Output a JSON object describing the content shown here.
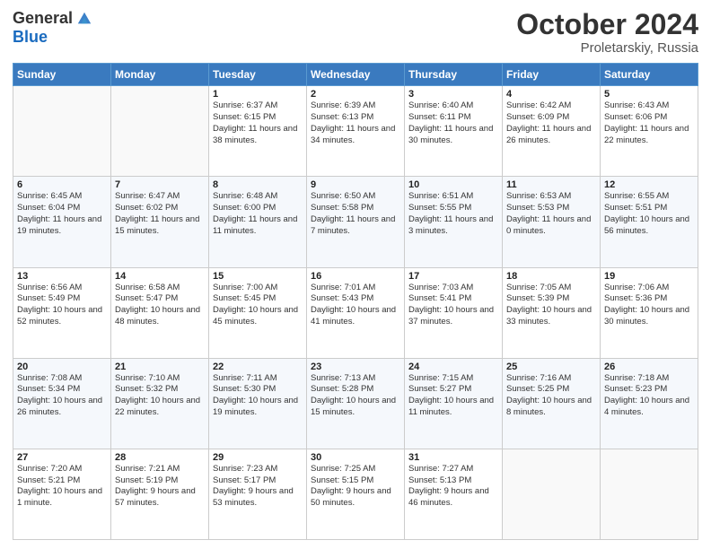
{
  "header": {
    "logo_general": "General",
    "logo_blue": "Blue",
    "month_title": "October 2024",
    "subtitle": "Proletarskiy, Russia"
  },
  "days_of_week": [
    "Sunday",
    "Monday",
    "Tuesday",
    "Wednesday",
    "Thursday",
    "Friday",
    "Saturday"
  ],
  "weeks": [
    [
      {
        "day": "",
        "info": ""
      },
      {
        "day": "",
        "info": ""
      },
      {
        "day": "1",
        "info": "Sunrise: 6:37 AM\nSunset: 6:15 PM\nDaylight: 11 hours and 38 minutes."
      },
      {
        "day": "2",
        "info": "Sunrise: 6:39 AM\nSunset: 6:13 PM\nDaylight: 11 hours and 34 minutes."
      },
      {
        "day": "3",
        "info": "Sunrise: 6:40 AM\nSunset: 6:11 PM\nDaylight: 11 hours and 30 minutes."
      },
      {
        "day": "4",
        "info": "Sunrise: 6:42 AM\nSunset: 6:09 PM\nDaylight: 11 hours and 26 minutes."
      },
      {
        "day": "5",
        "info": "Sunrise: 6:43 AM\nSunset: 6:06 PM\nDaylight: 11 hours and 22 minutes."
      }
    ],
    [
      {
        "day": "6",
        "info": "Sunrise: 6:45 AM\nSunset: 6:04 PM\nDaylight: 11 hours and 19 minutes."
      },
      {
        "day": "7",
        "info": "Sunrise: 6:47 AM\nSunset: 6:02 PM\nDaylight: 11 hours and 15 minutes."
      },
      {
        "day": "8",
        "info": "Sunrise: 6:48 AM\nSunset: 6:00 PM\nDaylight: 11 hours and 11 minutes."
      },
      {
        "day": "9",
        "info": "Sunrise: 6:50 AM\nSunset: 5:58 PM\nDaylight: 11 hours and 7 minutes."
      },
      {
        "day": "10",
        "info": "Sunrise: 6:51 AM\nSunset: 5:55 PM\nDaylight: 11 hours and 3 minutes."
      },
      {
        "day": "11",
        "info": "Sunrise: 6:53 AM\nSunset: 5:53 PM\nDaylight: 11 hours and 0 minutes."
      },
      {
        "day": "12",
        "info": "Sunrise: 6:55 AM\nSunset: 5:51 PM\nDaylight: 10 hours and 56 minutes."
      }
    ],
    [
      {
        "day": "13",
        "info": "Sunrise: 6:56 AM\nSunset: 5:49 PM\nDaylight: 10 hours and 52 minutes."
      },
      {
        "day": "14",
        "info": "Sunrise: 6:58 AM\nSunset: 5:47 PM\nDaylight: 10 hours and 48 minutes."
      },
      {
        "day": "15",
        "info": "Sunrise: 7:00 AM\nSunset: 5:45 PM\nDaylight: 10 hours and 45 minutes."
      },
      {
        "day": "16",
        "info": "Sunrise: 7:01 AM\nSunset: 5:43 PM\nDaylight: 10 hours and 41 minutes."
      },
      {
        "day": "17",
        "info": "Sunrise: 7:03 AM\nSunset: 5:41 PM\nDaylight: 10 hours and 37 minutes."
      },
      {
        "day": "18",
        "info": "Sunrise: 7:05 AM\nSunset: 5:39 PM\nDaylight: 10 hours and 33 minutes."
      },
      {
        "day": "19",
        "info": "Sunrise: 7:06 AM\nSunset: 5:36 PM\nDaylight: 10 hours and 30 minutes."
      }
    ],
    [
      {
        "day": "20",
        "info": "Sunrise: 7:08 AM\nSunset: 5:34 PM\nDaylight: 10 hours and 26 minutes."
      },
      {
        "day": "21",
        "info": "Sunrise: 7:10 AM\nSunset: 5:32 PM\nDaylight: 10 hours and 22 minutes."
      },
      {
        "day": "22",
        "info": "Sunrise: 7:11 AM\nSunset: 5:30 PM\nDaylight: 10 hours and 19 minutes."
      },
      {
        "day": "23",
        "info": "Sunrise: 7:13 AM\nSunset: 5:28 PM\nDaylight: 10 hours and 15 minutes."
      },
      {
        "day": "24",
        "info": "Sunrise: 7:15 AM\nSunset: 5:27 PM\nDaylight: 10 hours and 11 minutes."
      },
      {
        "day": "25",
        "info": "Sunrise: 7:16 AM\nSunset: 5:25 PM\nDaylight: 10 hours and 8 minutes."
      },
      {
        "day": "26",
        "info": "Sunrise: 7:18 AM\nSunset: 5:23 PM\nDaylight: 10 hours and 4 minutes."
      }
    ],
    [
      {
        "day": "27",
        "info": "Sunrise: 7:20 AM\nSunset: 5:21 PM\nDaylight: 10 hours and 1 minute."
      },
      {
        "day": "28",
        "info": "Sunrise: 7:21 AM\nSunset: 5:19 PM\nDaylight: 9 hours and 57 minutes."
      },
      {
        "day": "29",
        "info": "Sunrise: 7:23 AM\nSunset: 5:17 PM\nDaylight: 9 hours and 53 minutes."
      },
      {
        "day": "30",
        "info": "Sunrise: 7:25 AM\nSunset: 5:15 PM\nDaylight: 9 hours and 50 minutes."
      },
      {
        "day": "31",
        "info": "Sunrise: 7:27 AM\nSunset: 5:13 PM\nDaylight: 9 hours and 46 minutes."
      },
      {
        "day": "",
        "info": ""
      },
      {
        "day": "",
        "info": ""
      }
    ]
  ]
}
